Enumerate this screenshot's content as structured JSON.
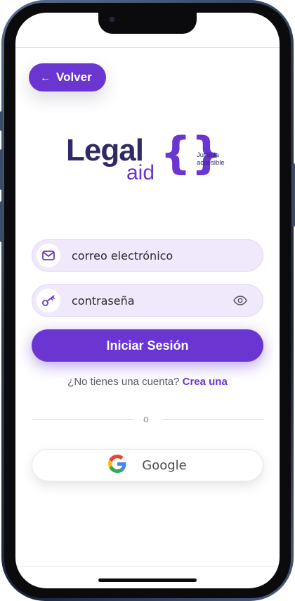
{
  "header": {
    "back_label": "Volver",
    "back_icon": "arrow-left-icon"
  },
  "logo": {
    "word_main": "Legal",
    "word_sub": "aid",
    "braces": "{}",
    "tagline_line1": "Justicia",
    "tagline_line2": "accesible"
  },
  "form": {
    "email": {
      "placeholder": "correo electrónico",
      "value": "",
      "icon": "mail-icon"
    },
    "password": {
      "placeholder": "contraseña",
      "value": "",
      "icon": "key-icon",
      "toggle_icon": "eye-icon"
    },
    "submit_label": "Iniciar Sesión"
  },
  "signup": {
    "prompt": "¿No tienes una cuenta?",
    "link_label": "Crea una"
  },
  "divider": {
    "label": "o"
  },
  "social": {
    "google_label": "Google",
    "google_icon": "google-icon"
  },
  "colors": {
    "accent": "#6a35d1",
    "logo_dark": "#2f2a66",
    "field_bg": "#efe9fb"
  }
}
